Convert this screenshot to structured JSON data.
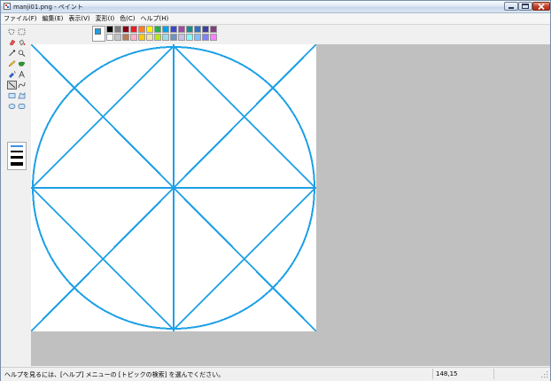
{
  "window": {
    "title": "manji01.png - ペイント",
    "icons": {
      "app": "paint-app-icon",
      "minimize": "minimize-icon",
      "maximize": "maximize-icon",
      "close": "close-icon"
    }
  },
  "menu": {
    "items": [
      "ファイル(F)",
      "編集(E)",
      "表示(V)",
      "変形(I)",
      "色(C)",
      "ヘルプ(H)"
    ]
  },
  "toolbox": {
    "tools": [
      "free-select",
      "rect-select",
      "eraser",
      "fill",
      "color-picker",
      "magnifier",
      "pencil",
      "brush",
      "airbrush",
      "text",
      "line",
      "curve",
      "rectangle",
      "polygon",
      "ellipse",
      "rounded-rect"
    ],
    "active": "line",
    "line_widths": [
      "1",
      "2",
      "3",
      "4"
    ],
    "selected_width_index": 0
  },
  "palette": {
    "foreground": "#1ea0e6",
    "background": "#ffffff",
    "colors_row1": [
      "#000000",
      "#7f7f7f",
      "#880015",
      "#ed1c24",
      "#ff7f27",
      "#fff200",
      "#22b14c",
      "#00a2e8",
      "#3f48cc",
      "#a349a4",
      "#1c8c8c",
      "#3070c0",
      "#4040a0",
      "#804080"
    ],
    "colors_row2": [
      "#ffffff",
      "#c3c3c3",
      "#b97a57",
      "#ffaec9",
      "#ffc90e",
      "#efe4b0",
      "#b5e61d",
      "#99d9ea",
      "#7092be",
      "#c8bfe7",
      "#80ffff",
      "#80c0ff",
      "#8080ff",
      "#ff80ff"
    ]
  },
  "drawing": {
    "stroke_color": "#1ea0e6",
    "shapes": "circle with horizontal, vertical and two diagonal lines"
  },
  "status": {
    "help_text": "ヘルプを見るには、[ヘルプ] メニューの [トピックの検索] を選んでください。",
    "coordinates": "148,15"
  }
}
